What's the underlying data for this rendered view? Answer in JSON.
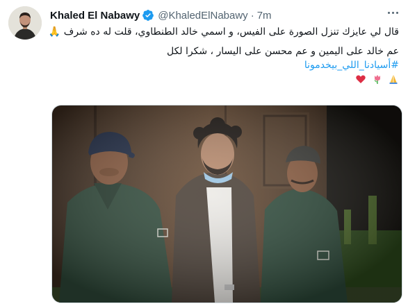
{
  "tweet": {
    "author_name": "Khaled El Nabawy",
    "handle": "@KhaledElNabawy",
    "separator": "·",
    "time": "7m",
    "text_line1": "قال لي عايزك تنزل الصورة على الفيس، و اسمي خالد الطنطاوي، قلت له ده شرف 🙏",
    "text_line2": "عم خالد على اليمين و عم محسن على اليسار ، شكرا لكل",
    "hashtag": "#أسيادنا_اللي_بيخدمونا",
    "emojis": [
      "pray",
      "tulip",
      "red-heart"
    ],
    "verified_color": "#1d9bf0",
    "link_color": "#1d9bf0"
  }
}
